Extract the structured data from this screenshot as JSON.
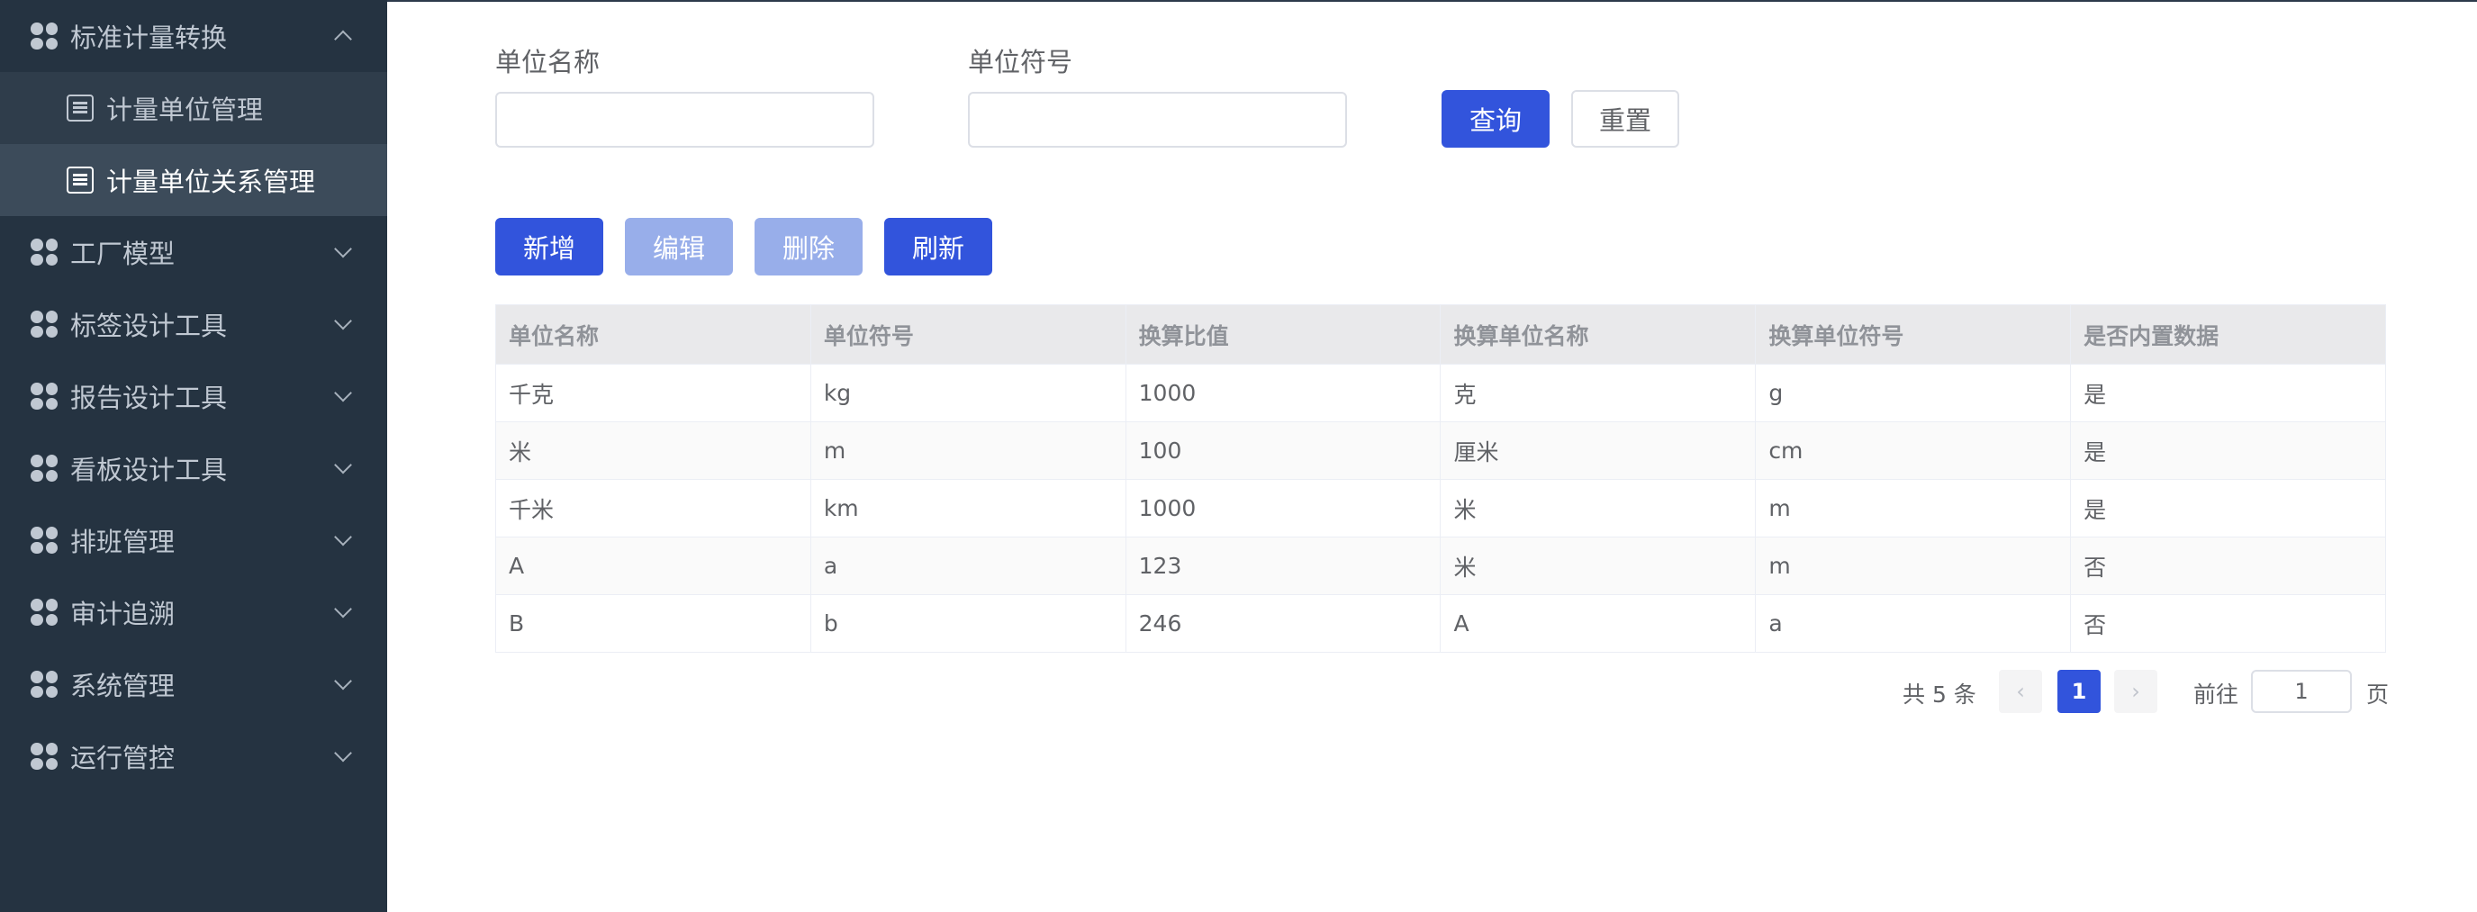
{
  "sidebar": {
    "groups": [
      {
        "label": "标准计量转换",
        "expanded": true
      },
      {
        "label": "工厂模型"
      },
      {
        "label": "标签设计工具"
      },
      {
        "label": "报告设计工具"
      },
      {
        "label": "看板设计工具"
      },
      {
        "label": "排班管理"
      },
      {
        "label": "审计追溯"
      },
      {
        "label": "系统管理"
      },
      {
        "label": "运行管控"
      }
    ],
    "sub_items": [
      {
        "label": "计量单位管理"
      },
      {
        "label": "计量单位关系管理",
        "active": true
      }
    ]
  },
  "search": {
    "unit_name_label": "单位名称",
    "unit_name_value": "",
    "unit_symbol_label": "单位符号",
    "unit_symbol_value": "",
    "query_label": "查询",
    "reset_label": "重置"
  },
  "toolbar": {
    "add_label": "新增",
    "edit_label": "编辑",
    "delete_label": "删除",
    "refresh_label": "刷新"
  },
  "table": {
    "headers": [
      "单位名称",
      "单位符号",
      "换算比值",
      "换算单位名称",
      "换算单位符号",
      "是否内置数据"
    ],
    "rows": [
      [
        "千克",
        "kg",
        "1000",
        "克",
        "g",
        "是"
      ],
      [
        "米",
        "m",
        "100",
        "厘米",
        "cm",
        "是"
      ],
      [
        "千米",
        "km",
        "1000",
        "米",
        "m",
        "是"
      ],
      [
        "A",
        "a",
        "123",
        "米",
        "m",
        "否"
      ],
      [
        "B",
        "b",
        "246",
        "A",
        "a",
        "否"
      ]
    ]
  },
  "pagination": {
    "total_text": "共 5 条",
    "current_page": "1",
    "goto_label": "前往",
    "goto_value": "1",
    "page_suffix": "页"
  },
  "colors": {
    "sidebar_bg": "#253341",
    "primary": "#3254dc",
    "disabled": "#98aeea"
  }
}
